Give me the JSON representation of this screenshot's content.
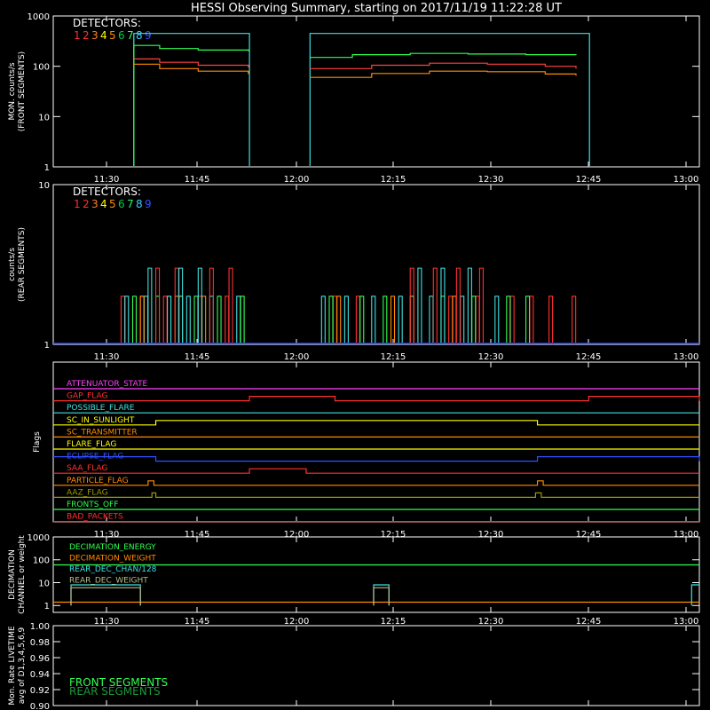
{
  "title": "HESSI Observing Summary, starting on 2017/11/19 11:22:28 UT",
  "time_ticks": [
    "11:30",
    "11:45",
    "12:00",
    "12:15",
    "12:30",
    "12:45",
    "13:00"
  ],
  "detector_colors": [
    "#ff3030",
    "#ff3030",
    "#ff7f1f",
    "#ffff00",
    "#ff8a00",
    "#00cc44",
    "#20ff70",
    "#40c8ff",
    "#3050ff"
  ],
  "chart_data": [
    {
      "type": "line",
      "title": "",
      "ylabel": [
        "MON. counts/s",
        "(FRONT SEGMENTS)"
      ],
      "legend_title": "DETECTORS:",
      "legend_items": [
        "1",
        "2",
        "3",
        "4",
        "5",
        "6",
        "7",
        "8",
        "9"
      ],
      "y_scale": "log",
      "ylim": [
        1,
        1000
      ],
      "yticks": [
        "1",
        "10",
        "100",
        "1000"
      ],
      "x_unit": "hours",
      "xlim": [
        11.374,
        13.05
      ],
      "series": [
        {
          "color": "#40e0e0",
          "segments": [
            [
              [
                11.583,
                1
              ],
              [
                11.583,
                450
              ],
              [
                11.883,
                450
              ],
              [
                11.883,
                1
              ]
            ],
            [
              [
                12.04,
                1
              ],
              [
                12.04,
                450
              ],
              [
                12.765,
                450
              ],
              [
                12.765,
                1
              ]
            ]
          ]
        },
        {
          "color": "#30ff50",
          "segments": [
            [
              [
                11.583,
                1
              ],
              [
                11.583,
                260
              ],
              [
                11.65,
                225
              ],
              [
                11.75,
                210
              ],
              [
                11.88,
                200
              ]
            ],
            [
              [
                12.04,
                150
              ],
              [
                12.15,
                170
              ],
              [
                12.3,
                180
              ],
              [
                12.45,
                175
              ],
              [
                12.6,
                170
              ],
              [
                12.73,
                165
              ]
            ]
          ]
        },
        {
          "color": "#ff4040",
          "segments": [
            [
              [
                11.583,
                140
              ],
              [
                11.65,
                120
              ],
              [
                11.75,
                105
              ],
              [
                11.88,
                95
              ]
            ],
            [
              [
                12.04,
                90
              ],
              [
                12.2,
                105
              ],
              [
                12.35,
                115
              ],
              [
                12.5,
                110
              ],
              [
                12.65,
                100
              ],
              [
                12.73,
                90
              ]
            ]
          ]
        },
        {
          "color": "#ff8a00",
          "segments": [
            [
              [
                11.583,
                110
              ],
              [
                11.65,
                90
              ],
              [
                11.75,
                80
              ],
              [
                11.88,
                70
              ]
            ],
            [
              [
                12.04,
                60
              ],
              [
                12.2,
                72
              ],
              [
                12.35,
                80
              ],
              [
                12.5,
                78
              ],
              [
                12.65,
                70
              ],
              [
                12.73,
                65
              ]
            ]
          ]
        }
      ]
    },
    {
      "type": "line",
      "title": "",
      "ylabel": [
        "counts/s",
        "(REAR SEGMENTS)"
      ],
      "legend_title": "DETECTORS:",
      "legend_items": [
        "1",
        "2",
        "3",
        "4",
        "5",
        "6",
        "7",
        "8",
        "9"
      ],
      "y_scale": "log",
      "ylim": [
        1,
        10
      ],
      "yticks": [
        "1",
        "10"
      ],
      "x_unit": "hours",
      "xlim": [
        11.374,
        13.05
      ],
      "baseline": {
        "color": "#2040ff",
        "value": 1
      },
      "sparse_spikes": [
        {
          "color": "#ff3030",
          "times": [
            11.55,
            11.6,
            11.66,
            11.7,
            11.75,
            11.82,
            12.1,
            12.16,
            12.3,
            12.4,
            12.47,
            12.56,
            12.61,
            12.66,
            12.72
          ],
          "value": 2
        },
        {
          "color": "#40e0e0",
          "times": [
            11.56,
            11.61,
            11.67,
            11.72,
            11.78,
            11.85,
            12.07,
            12.13,
            12.2,
            12.27,
            12.35,
            12.43,
            12.52
          ],
          "value": 2
        },
        {
          "color": "#30ff50",
          "times": [
            11.58,
            11.64,
            11.7,
            11.74,
            11.8,
            11.86,
            12.09,
            12.17,
            12.23,
            12.3,
            12.38,
            12.46,
            12.55,
            12.6
          ],
          "value": 2
        },
        {
          "color": "#ff8a00",
          "times": [
            11.6,
            11.69,
            11.76,
            12.11,
            12.25,
            12.41
          ],
          "value": 2
        },
        {
          "color": "#ff3030",
          "times": [
            11.64,
            11.69,
            11.78,
            11.83,
            12.3,
            12.36,
            12.42,
            12.48
          ],
          "value": 3
        },
        {
          "color": "#40e0e0",
          "times": [
            11.62,
            11.7,
            11.75,
            12.32,
            12.38,
            12.45
          ],
          "value": 3
        }
      ]
    },
    {
      "type": "line",
      "title": "",
      "ylabel": [
        "Flags"
      ],
      "x_unit": "hours",
      "xlim": [
        11.374,
        13.05
      ],
      "flags": [
        {
          "label": "ATTENUATOR_STATE",
          "color": "#ff40ff",
          "steps": []
        },
        {
          "label": "GAP_FLAG",
          "color": "#ff3030",
          "steps": [
            [
              11.883,
              12.105
            ],
            [
              12.763,
              13.05
            ]
          ]
        },
        {
          "label": "POSSIBLE_FLARE",
          "color": "#40e0e0",
          "steps": []
        },
        {
          "label": "SC_IN_SUNLIGHT",
          "color": "#ffff00",
          "steps": [
            [
              11.64,
              12.63
            ]
          ]
        },
        {
          "label": "SC_TRANSMITTER",
          "color": "#ff8a00",
          "steps": []
        },
        {
          "label": "FLARE_FLAG",
          "color": "#ffff00",
          "steps": []
        },
        {
          "label": "ECLIPSE_FLAG",
          "color": "#3050ff",
          "steps": [
            [
              11.374,
              11.64
            ],
            [
              12.63,
              13.05
            ]
          ]
        },
        {
          "label": "SAA_FLAG",
          "color": "#ff3030",
          "steps": [
            [
              11.883,
              12.03
            ]
          ]
        },
        {
          "label": "PARTICLE_FLAG",
          "color": "#ff8a00",
          "steps": [
            [
              11.62,
              11.635
            ],
            [
              12.63,
              12.645
            ]
          ]
        },
        {
          "label": "AAZ_FLAG",
          "color": "#999900",
          "steps": [
            [
              11.63,
              11.64
            ],
            [
              12.625,
              12.64
            ]
          ]
        },
        {
          "label": "FRONTS_OFF",
          "color": "#30ff50",
          "steps": []
        },
        {
          "label": "BAD_PACKETS",
          "color": "#ff3030",
          "steps": []
        }
      ]
    },
    {
      "type": "line",
      "title": "",
      "ylabel": [
        "DECIMATION",
        "CHANNEL or weight"
      ],
      "y_scale": "log",
      "ylim": [
        0.5,
        1000
      ],
      "yticks": [
        "1",
        "10",
        "100",
        "1000"
      ],
      "x_unit": "hours",
      "xlim": [
        11.374,
        13.05
      ],
      "legend_items": [
        "DECIMATION_ENERGY",
        "DECIMATION_WEIGHT",
        "REAR_DEC_CHAN/128",
        "REAR_DEC_WEIGHT"
      ],
      "legend_colors": [
        "#30ff50",
        "#ff8a00",
        "#40e0e0",
        "#bbbb88"
      ],
      "series": [
        {
          "name": "DECIMATION_ENERGY",
          "color": "#30ff50",
          "segments": [
            [
              [
                11.374,
                60
              ],
              [
                13.05,
                60
              ]
            ]
          ]
        },
        {
          "name": "DECIMATION_WEIGHT",
          "color": "#ff8a00",
          "segments": [
            [
              [
                11.374,
                1.4
              ],
              [
                13.05,
                1.4
              ]
            ]
          ]
        },
        {
          "name": "REAR_DEC_CHAN/128",
          "color": "#40e0e0",
          "segments": [
            [
              [
                11.42,
                1
              ],
              [
                11.42,
                8
              ],
              [
                11.6,
                8
              ],
              [
                11.6,
                1
              ]
            ],
            [
              [
                12.205,
                1
              ],
              [
                12.205,
                8
              ],
              [
                12.245,
                8
              ],
              [
                12.245,
                1
              ]
            ],
            [
              [
                13.03,
                1
              ],
              [
                13.03,
                8
              ],
              [
                13.05,
                8
              ]
            ]
          ]
        },
        {
          "name": "REAR_DEC_WEIGHT",
          "color": "#bbbb88",
          "segments": [
            [
              [
                11.42,
                1
              ],
              [
                11.42,
                6
              ],
              [
                11.6,
                6
              ],
              [
                11.6,
                1
              ]
            ],
            [
              [
                12.205,
                1
              ],
              [
                12.205,
                6
              ],
              [
                12.245,
                6
              ],
              [
                12.245,
                1
              ]
            ]
          ]
        }
      ]
    },
    {
      "type": "line",
      "title": "",
      "ylabel": [
        "Mon. Rate LIVETIME",
        "avg of D1,3,4,5,6,9"
      ],
      "ylim": [
        0.9,
        1.0
      ],
      "yticks": [
        "0.90",
        "0.92",
        "0.94",
        "0.96",
        "0.98",
        "1.00"
      ],
      "x_unit": "hours",
      "xlim": [
        11.374,
        13.05
      ],
      "legend_items": [
        "FRONT SEGMENTS",
        "REAR SEGMENTS"
      ],
      "legend_colors": [
        "#30ff50",
        "#1a9a3a"
      ],
      "series": []
    }
  ]
}
